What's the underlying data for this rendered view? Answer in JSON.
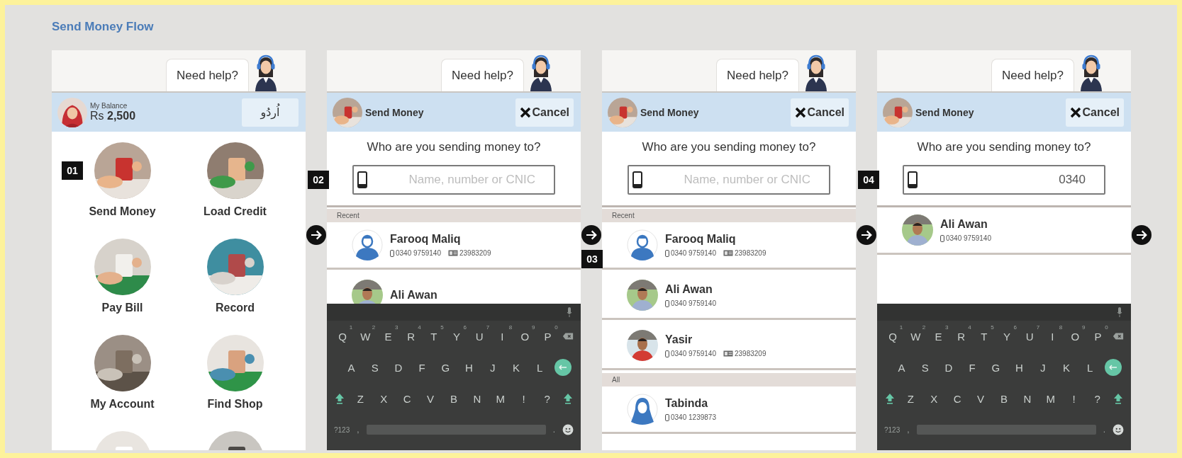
{
  "title": "Send Money Flow",
  "screens": [
    {
      "kind": "home",
      "help": "Need help?",
      "header": {
        "balance_label": "My Balance",
        "balance": "Rs **2,500**",
        "language_button": "اُردُو"
      },
      "tiles": [
        {
          "kind": "full",
          "label": "Send Money",
          "step": "01"
        },
        {
          "kind": "full",
          "label": "Load Credit"
        },
        {
          "kind": "full",
          "label": "Pay Bill"
        },
        {
          "kind": "full",
          "label": "Record"
        },
        {
          "kind": "full",
          "label": "My Account"
        },
        {
          "kind": "full",
          "label": "Find Shop"
        },
        {
          "kind": "cut"
        },
        {
          "kind": "cut"
        }
      ]
    },
    {
      "kind": "search",
      "help": "Need help?",
      "header": {
        "title": "Send Money",
        "cancel": "Cancel"
      },
      "question": "Who are you sending money to?",
      "field": {
        "placeholder": "Name, number or CNIC",
        "step": "02"
      },
      "list": [
        {
          "kind": "section",
          "label": "Recent"
        },
        {
          "kind": "contact",
          "avatar": {
            "kind": "male"
          },
          "name": "Farooq Maliq",
          "phone": "0340 9759140",
          "cnic": "23983209"
        },
        {
          "kind": "contact",
          "name": "Ali Awan"
        }
      ],
      "keyboard": {
        "hints": [
          "1",
          "2",
          "3",
          "4",
          "5",
          "6",
          "7",
          "8",
          "9",
          "0"
        ],
        "top_row": [
          "Q",
          "W",
          "E",
          "R",
          "T",
          "Y",
          "U",
          "I",
          "O",
          "P"
        ],
        "middle_row": [
          "A",
          "S",
          "D",
          "F",
          "G",
          "H",
          "J",
          "K",
          "L"
        ],
        "bottom_row": [
          "Z",
          "X",
          "C",
          "V",
          "B",
          "N",
          "M",
          "!",
          "?"
        ],
        "symbols": "?123",
        "comma": ",",
        "period": "."
      }
    },
    {
      "kind": "search",
      "help": "Need help?",
      "header": {
        "title": "Send Money",
        "cancel": "Cancel"
      },
      "question": "Who are you sending money to?",
      "field": {
        "placeholder": "Name, number or CNIC"
      },
      "list": [
        {
          "kind": "section",
          "label": "Recent"
        },
        {
          "kind": "contact",
          "avatar": {
            "kind": "male"
          },
          "name": "Farooq Maliq",
          "phone": "0340 9759140",
          "cnic": "23983209",
          "step": "03"
        },
        {
          "kind": "contact",
          "name": "Ali Awan",
          "phone": "0340 9759140"
        },
        {
          "kind": "contact",
          "name": "Yasir",
          "phone": "0340 9759140",
          "cnic": "23983209"
        },
        {
          "kind": "section",
          "label": "All"
        },
        {
          "kind": "contact",
          "avatar": {
            "kind": "female"
          },
          "name": "Tabinda",
          "phone": "0340 1239873"
        }
      ]
    },
    {
      "kind": "search",
      "help": "Need help?",
      "header": {
        "title": "Send Money",
        "cancel": "Cancel"
      },
      "question": "Who are you sending money to?",
      "field": {
        "value": "0340",
        "step": "04"
      },
      "list": [
        {
          "kind": "contact",
          "name": "Ali Awan",
          "phone": "0340 9759140"
        }
      ],
      "keyboard": {
        "hints": [
          "1",
          "2",
          "3",
          "4",
          "5",
          "6",
          "7",
          "8",
          "9",
          "0"
        ],
        "top_row": [
          "Q",
          "W",
          "E",
          "R",
          "T",
          "Y",
          "U",
          "I",
          "O",
          "P"
        ],
        "middle_row": [
          "A",
          "S",
          "D",
          "F",
          "G",
          "H",
          "J",
          "K",
          "L"
        ],
        "bottom_row": [
          "Z",
          "X",
          "C",
          "V",
          "B",
          "N",
          "M",
          "!",
          "?"
        ],
        "symbols": "?123",
        "comma": ",",
        "period": "."
      }
    }
  ]
}
